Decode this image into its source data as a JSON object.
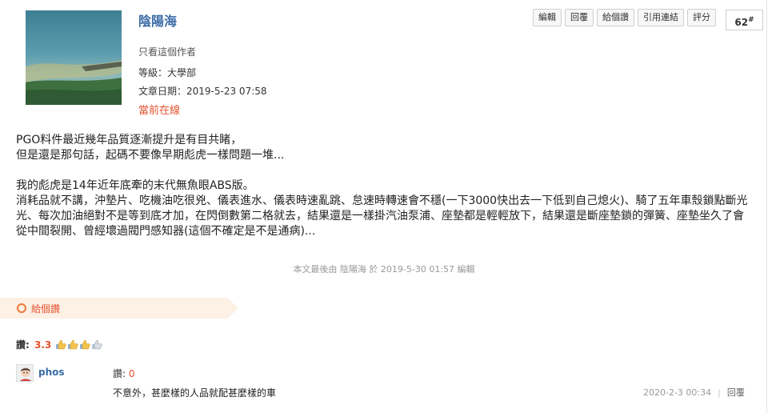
{
  "author": {
    "name": "陰陽海",
    "only_this_author": "只看這個作者",
    "level_label": "等級：",
    "level_value": "大學部",
    "date_label": "文章日期：",
    "date_value": "2019-5-23 07:58",
    "status": "當前在線"
  },
  "actions": [
    "編輯",
    "回覆",
    "給個讚",
    "引用連結",
    "評分"
  ],
  "floor": {
    "number": "62",
    "mark": "#"
  },
  "post": {
    "para1": [
      "PGO料件最近幾年品質逐漸提升是有目共睹，",
      "但是還是那句話，起碼不要像早期彪虎一樣問題一堆..."
    ],
    "para2": [
      "我的彪虎是14年近年底牽的末代無魚眼ABS版。",
      "消耗品就不講，沖墊片、吃機油吃很兇、儀表進水、儀表時速亂跳、怠速時轉速會不穩(一下3000快出去一下低到自己熄火)、騎了五年車殼鎖點斷光光、每次加油絕對不是等到底才加，在閃倒數第二格就去，結果還是一樣掛汽油泵浦、座墊都是輕輕放下，結果還是斷座墊鎖的彈簧、座墊坐久了會從中間裂開、曾經壞過閥門感知器(這個不確定是不是通病)..."
    ],
    "edited_note": "本文最後由 陰陽海 於 2019-5-30 01:57 編輯"
  },
  "rating": {
    "give_like": "給個讚",
    "score_label": "讚:",
    "score_value": "3.3",
    "thumbs_count": 4
  },
  "comment": {
    "user": "phos",
    "score_label": "讚:",
    "score_value": "0",
    "text": "不意外，甚麼樣的人品就配甚麼樣的車",
    "time": "2020-2-3 00:34",
    "separator": "|",
    "reply": "回覆"
  },
  "colors": {
    "accent": "#e5522f",
    "link": "#3a6ca6",
    "band": "#fdf0e4"
  }
}
